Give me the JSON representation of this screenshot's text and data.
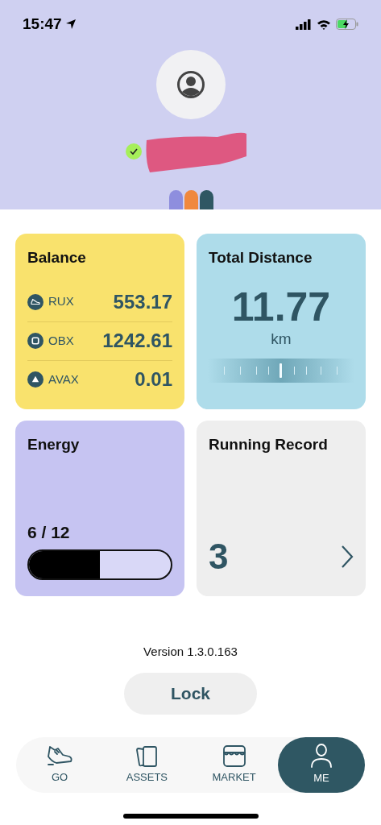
{
  "status_bar": {
    "time": "15:47"
  },
  "profile": {
    "verified": true,
    "tags": [
      {
        "color": "#8e8ede"
      },
      {
        "color": "#f0883e"
      },
      {
        "color": "#2f5763"
      }
    ]
  },
  "balance": {
    "title": "Balance",
    "rows": [
      {
        "kind": "shoe",
        "symbol": "RUX",
        "amount": "553.17"
      },
      {
        "kind": "square",
        "symbol": "OBX",
        "amount": "1242.61"
      },
      {
        "kind": "triangle",
        "symbol": "AVAX",
        "amount": "0.01"
      }
    ]
  },
  "total_distance": {
    "title": "Total Distance",
    "value": "11.77",
    "unit": "km"
  },
  "energy": {
    "title": "Energy",
    "reading": "6 / 12",
    "level": 0.5
  },
  "running_record": {
    "title": "Running Record",
    "count": "3"
  },
  "version": "Version 1.3.0.163",
  "lock_button": "Lock",
  "nav": [
    {
      "kind": "shoe",
      "label": "GO",
      "selected": false
    },
    {
      "kind": "cards",
      "label": "ASSETS",
      "selected": false
    },
    {
      "kind": "store",
      "label": "MARKET",
      "selected": false
    },
    {
      "kind": "person",
      "label": "ME",
      "selected": true
    }
  ]
}
